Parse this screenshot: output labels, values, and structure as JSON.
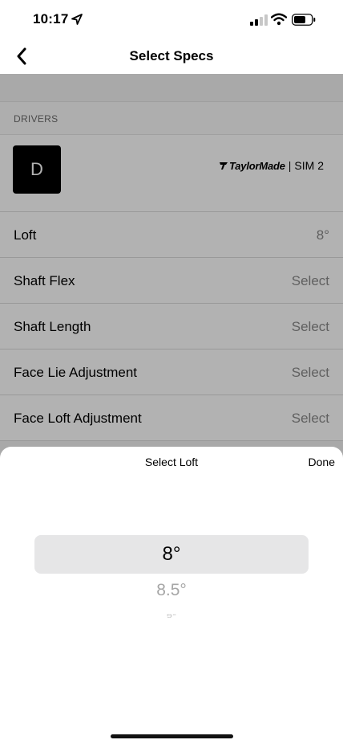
{
  "status": {
    "time": "10:17"
  },
  "nav": {
    "title": "Select Specs"
  },
  "section": {
    "header": "DRIVERS"
  },
  "product": {
    "badge": "D",
    "brand": "TaylorMade",
    "separator": "|",
    "model": "SIM 2"
  },
  "specs": [
    {
      "label": "Loft",
      "value": "8°"
    },
    {
      "label": "Shaft Flex",
      "value": "Select"
    },
    {
      "label": "Shaft Length",
      "value": "Select"
    },
    {
      "label": "Face Lie Adjustment",
      "value": "Select"
    },
    {
      "label": "Face Loft Adjustment",
      "value": "Select"
    }
  ],
  "picker": {
    "title": "Select Loft",
    "done": "Done",
    "options": [
      "8°",
      "8.5°",
      "9°"
    ],
    "selected_index": 0
  },
  "icons": {
    "back": "chevron-left-icon",
    "location": "location-arrow-icon",
    "signal": "cellular-signal-icon",
    "wifi": "wifi-icon",
    "battery": "battery-icon"
  }
}
